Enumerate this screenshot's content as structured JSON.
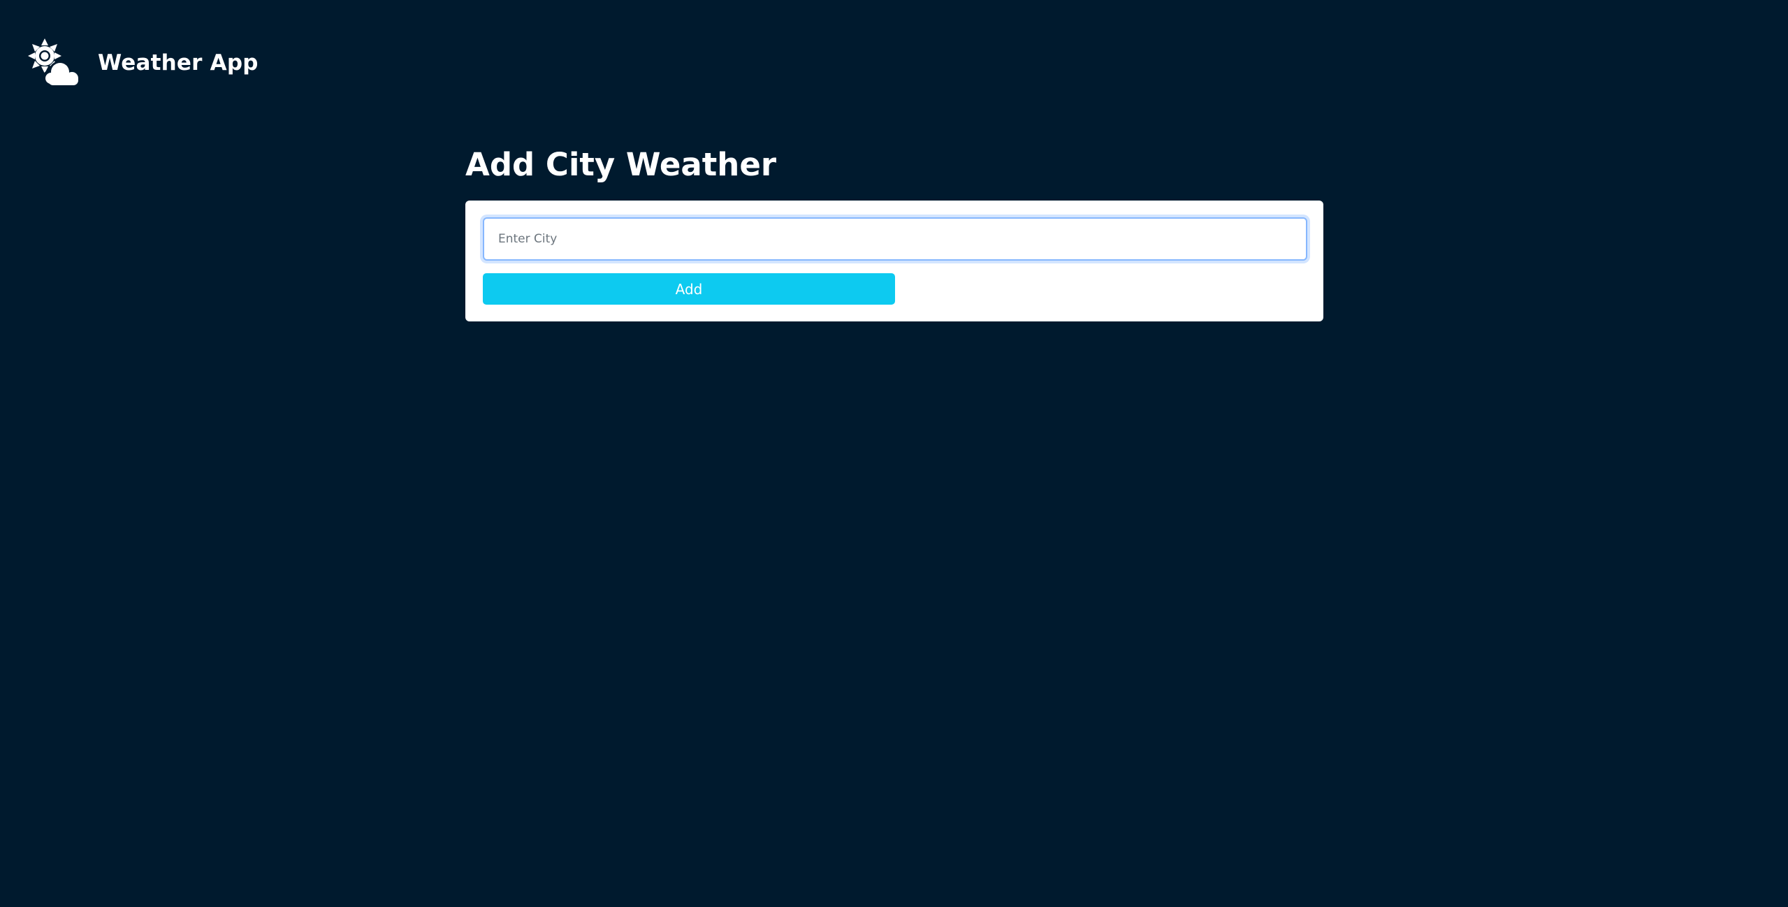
{
  "app": {
    "title": "Weather App",
    "logo_icon": "sun-cloud-icon"
  },
  "main": {
    "heading": "Add City Weather",
    "city_input": {
      "value": "",
      "placeholder": "Enter City"
    },
    "add_button_label": "Add"
  },
  "colors": {
    "background": "#001a2e",
    "card": "#ffffff",
    "accent": "#0dcaf0",
    "input_focus_border": "#86b7fe"
  }
}
